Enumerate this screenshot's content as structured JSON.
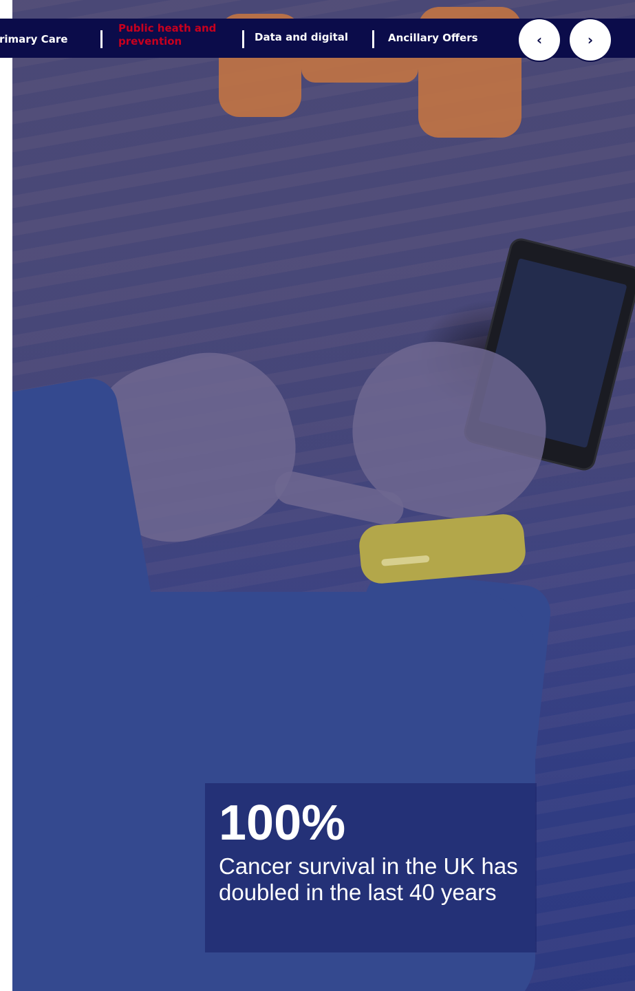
{
  "nav": {
    "items": [
      {
        "label": "Primary Care",
        "active": false
      },
      {
        "label": "Public heath and prevention",
        "active": true
      },
      {
        "label": "Data and digital",
        "active": false
      },
      {
        "label": "Ancillary Offers",
        "active": false
      }
    ],
    "prev_glyph": "‹",
    "next_glyph": "›",
    "active_color": "#c8001e",
    "bar_color": "#0b0c4a"
  },
  "stat": {
    "number": "100%",
    "text": "Cancer survival in the UK has doubled in the last 40 years"
  },
  "icons": [
    "chevron-left-icon",
    "chevron-right-icon"
  ]
}
